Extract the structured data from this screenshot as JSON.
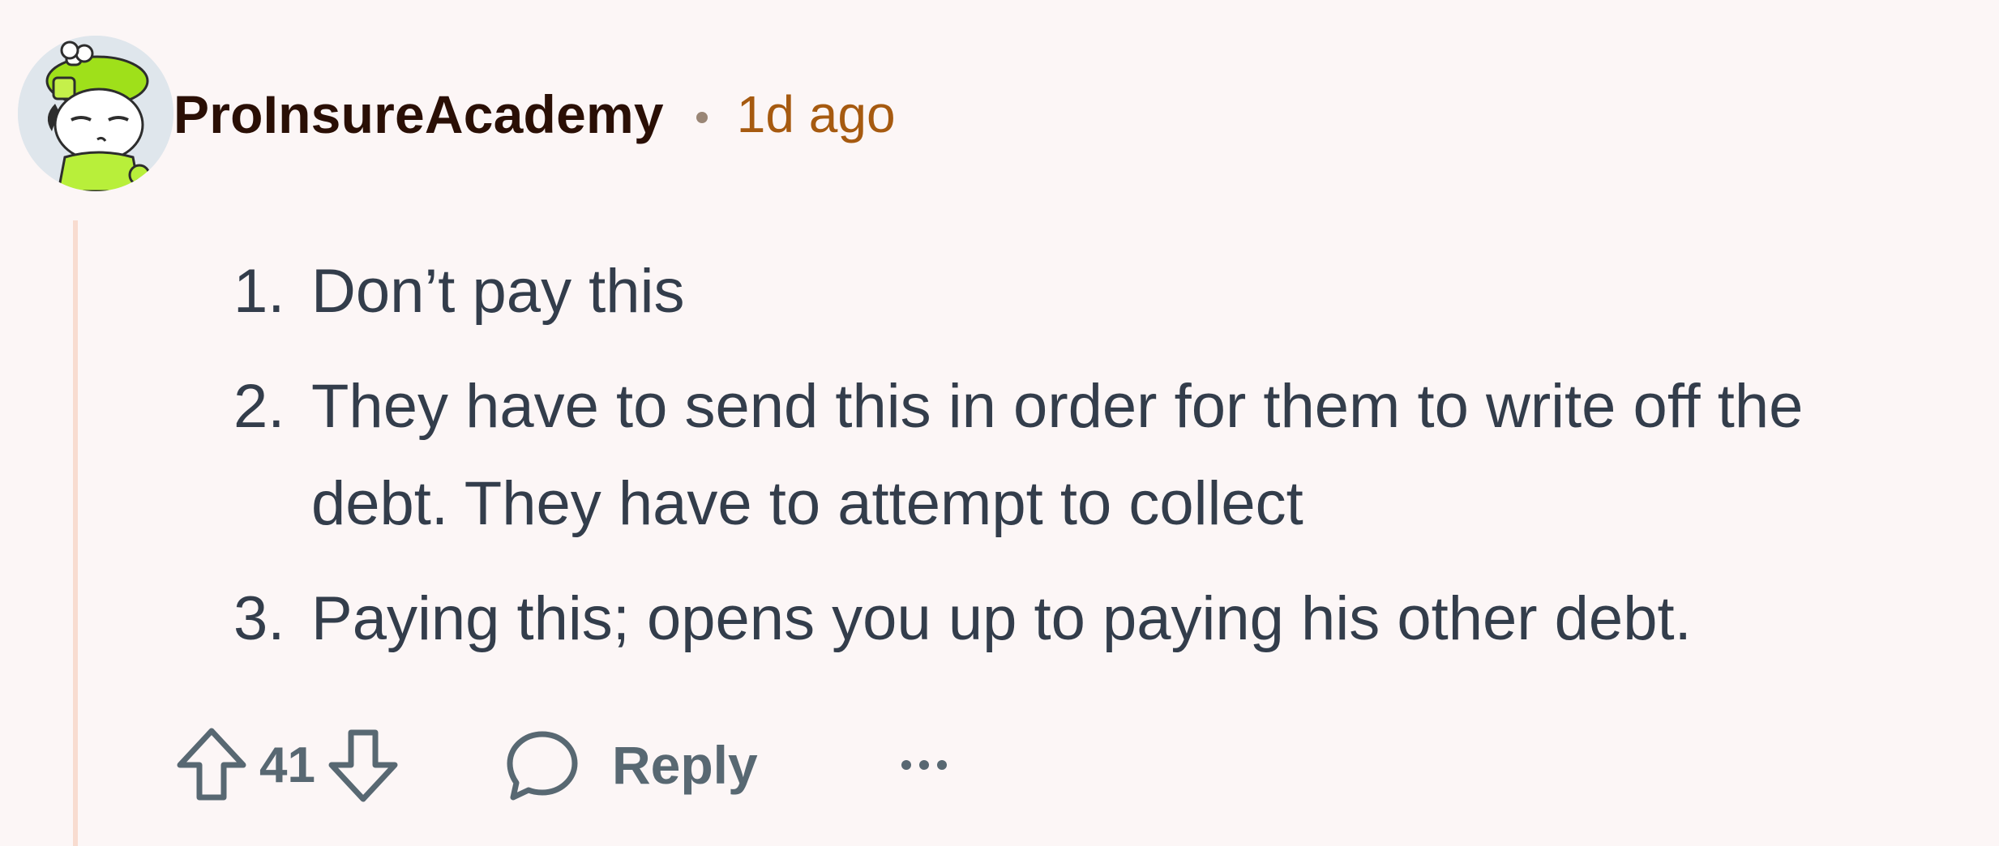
{
  "comment": {
    "username": "ProInsureAcademy",
    "timestamp": "1d ago",
    "body": [
      {
        "number": "1.",
        "text": "Don’t pay this"
      },
      {
        "number": "2.",
        "text": "They have to send this in order for them to write off the debt. They have to attempt to collect"
      },
      {
        "number": "3.",
        "text": "Paying this; opens you up to paying his other debt."
      }
    ]
  },
  "actions": {
    "vote_count": "41",
    "reply_label": "Reply",
    "upvote_icon": "arrow-up-outline-icon",
    "downvote_icon": "arrow-down-outline-icon",
    "reply_icon": "speech-bubble-icon",
    "more_icon": "ellipsis-icon"
  },
  "colors": {
    "background": "#fcf6f6",
    "username": "#2a0f05",
    "timestamp": "#a65a10",
    "body_text": "#333d4b",
    "action_text": "#586872",
    "thread_line": "#f8dcd0"
  }
}
